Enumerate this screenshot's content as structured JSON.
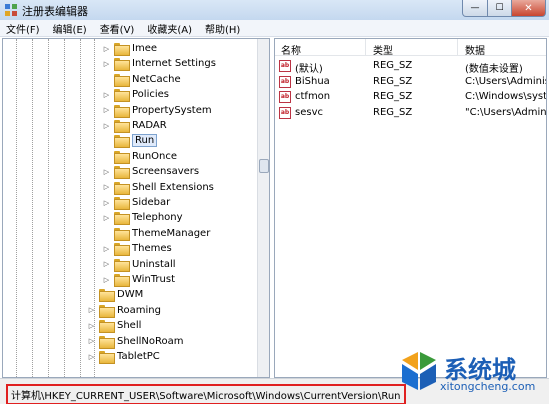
{
  "window": {
    "title": "注册表编辑器",
    "min_glyph": "—",
    "max_glyph": "☐",
    "close_glyph": "✕"
  },
  "menu": [
    "文件(F)",
    "编辑(E)",
    "查看(V)",
    "收藏夹(A)",
    "帮助(H)"
  ],
  "tree": {
    "items": [
      {
        "label": "Imee",
        "expander": "▷",
        "level": 2
      },
      {
        "label": "Internet Settings",
        "expander": "▷",
        "level": 2
      },
      {
        "label": "NetCache",
        "expander": "",
        "level": 2
      },
      {
        "label": "Policies",
        "expander": "▷",
        "level": 2
      },
      {
        "label": "PropertySystem",
        "expander": "▷",
        "level": 2
      },
      {
        "label": "RADAR",
        "expander": "▷",
        "level": 2
      },
      {
        "label": "Run",
        "expander": "",
        "level": 2,
        "selected": true
      },
      {
        "label": "RunOnce",
        "expander": "",
        "level": 2
      },
      {
        "label": "Screensavers",
        "expander": "▷",
        "level": 2
      },
      {
        "label": "Shell Extensions",
        "expander": "▷",
        "level": 2
      },
      {
        "label": "Sidebar",
        "expander": "▷",
        "level": 2
      },
      {
        "label": "Telephony",
        "expander": "▷",
        "level": 2
      },
      {
        "label": "ThemeManager",
        "expander": "",
        "level": 2
      },
      {
        "label": "Themes",
        "expander": "▷",
        "level": 2
      },
      {
        "label": "Uninstall",
        "expander": "▷",
        "level": 2
      },
      {
        "label": "WinTrust",
        "expander": "▷",
        "level": 2
      },
      {
        "label": "DWM",
        "expander": "",
        "level": 1
      },
      {
        "label": "Roaming",
        "expander": "▷",
        "level": 1
      },
      {
        "label": "Shell",
        "expander": "▷",
        "level": 1
      },
      {
        "label": "ShellNoRoam",
        "expander": "▷",
        "level": 1
      },
      {
        "label": "TabletPC",
        "expander": "▷",
        "level": 1
      }
    ]
  },
  "list": {
    "headers": {
      "name": "名称",
      "type": "类型",
      "data": "数据"
    },
    "rows": [
      {
        "icon": "ab",
        "name": "(默认)",
        "type": "REG_SZ",
        "data": "(数值未设置)"
      },
      {
        "icon": "ab",
        "name": "BiShua",
        "type": "REG_SZ",
        "data": "C:\\Users\\Administ"
      },
      {
        "icon": "ab",
        "name": "ctfmon",
        "type": "REG_SZ",
        "data": "C:\\Windows\\syste"
      },
      {
        "icon": "ab",
        "name": "sesvc",
        "type": "REG_SZ",
        "data": "\"C:\\Users\\Admini"
      }
    ]
  },
  "status": {
    "path": "计算机\\HKEY_CURRENT_USER\\Software\\Microsoft\\Windows\\CurrentVersion\\Run",
    "highlight_color": "#e02020"
  },
  "watermark": {
    "brand": "系统城",
    "url": "xitongcheng.com"
  }
}
